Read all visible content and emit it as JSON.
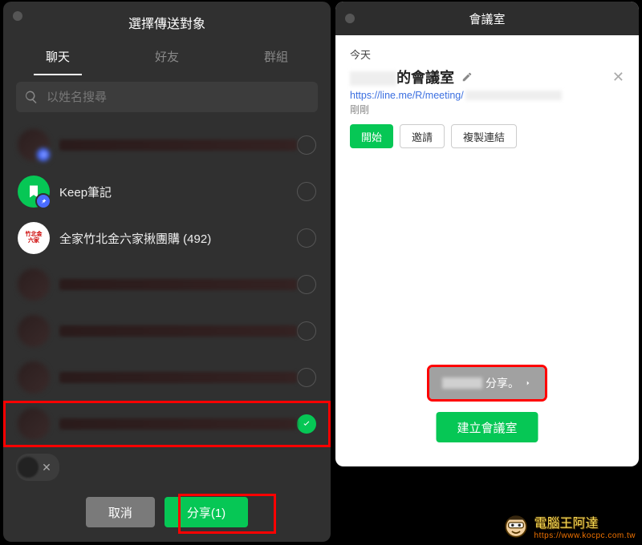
{
  "left": {
    "title": "選擇傳送對象",
    "tabs": [
      {
        "label": "聊天",
        "active": true
      },
      {
        "label": "好友",
        "active": false
      },
      {
        "label": "群組",
        "active": false
      }
    ],
    "search_placeholder": "以姓名搜尋",
    "rows": [
      {
        "name": "",
        "avatar": "blur",
        "pin": true,
        "checked": false,
        "hidden": true
      },
      {
        "name": "Keep筆記",
        "avatar": "keep",
        "pin": true,
        "checked": false
      },
      {
        "name": "全家竹北金六家揪團購 (492)",
        "avatar": "fam",
        "pin": false,
        "checked": false
      },
      {
        "name": "",
        "avatar": "blur",
        "pin": false,
        "checked": false,
        "hidden": true
      },
      {
        "name": "",
        "avatar": "blur",
        "pin": false,
        "checked": false,
        "hidden": true
      },
      {
        "name": "",
        "avatar": "blur",
        "pin": false,
        "checked": false,
        "hidden": true
      },
      {
        "name": "",
        "avatar": "blur",
        "pin": false,
        "checked": true,
        "hidden": true,
        "highlight": true
      }
    ],
    "cancel_label": "取消",
    "share_label": "分享(1)"
  },
  "right": {
    "title": "會議室",
    "today_label": "今天",
    "meeting_suffix": "的會議室",
    "link_text": "https://line.me/R/meeting/",
    "time_label": "剛剛",
    "start_label": "開始",
    "invite_label": "邀請",
    "copy_label": "複製連結",
    "toast_text": "分享。",
    "create_label": "建立會議室"
  },
  "watermark": {
    "line1": "電腦王阿達",
    "line2": "https://www.kocpc.com.tw"
  }
}
